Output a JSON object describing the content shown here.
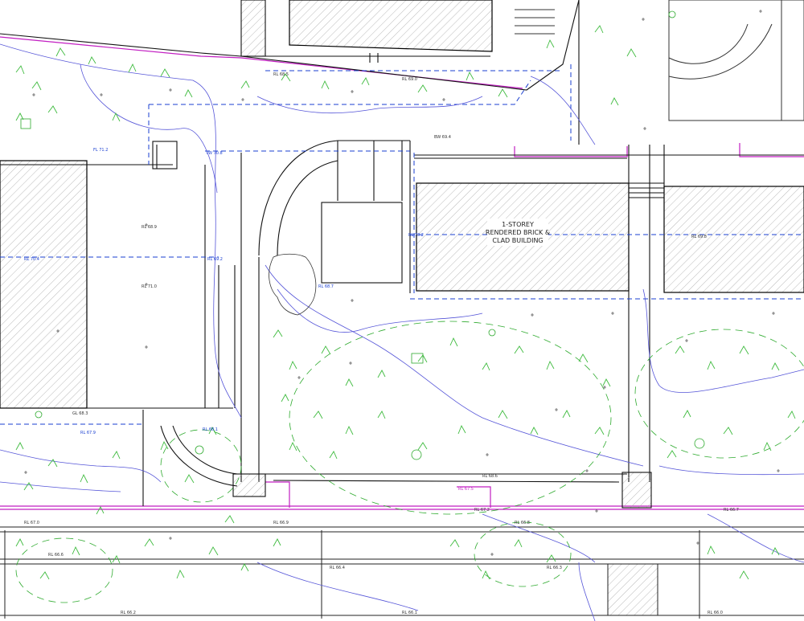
{
  "building": {
    "line1": "1-STOREY",
    "line2": "RENDERED BRICK &",
    "line3": "CLAD BUILDING"
  },
  "levels": [
    "RL 68.5",
    "RL 69.0",
    "FL 71.2",
    "TW 70.8",
    "BW 69.4",
    "RL 68.9",
    "RL 70.4",
    "RL 71.0",
    "RL 69.2",
    "RL 68.7",
    "GL 68.3",
    "RL 67.9",
    "RL 68.1",
    "RL 69.8",
    "RL 70.2",
    "RL 68.6",
    "RL 67.5",
    "RL 67.2",
    "RL 66.9",
    "RL 67.0",
    "RL 66.8",
    "RL 66.7",
    "RL 66.6",
    "RL 66.4",
    "RL 66.3",
    "RL 66.2",
    "RL 66.1",
    "RL 66.0"
  ],
  "colors": {
    "linework": "#000000",
    "services": "#1a3fd1",
    "boundary": "#c21ec2",
    "vegetation": "#2eaa2e",
    "contours": "#4d4dd6",
    "hatch": "#999999"
  }
}
